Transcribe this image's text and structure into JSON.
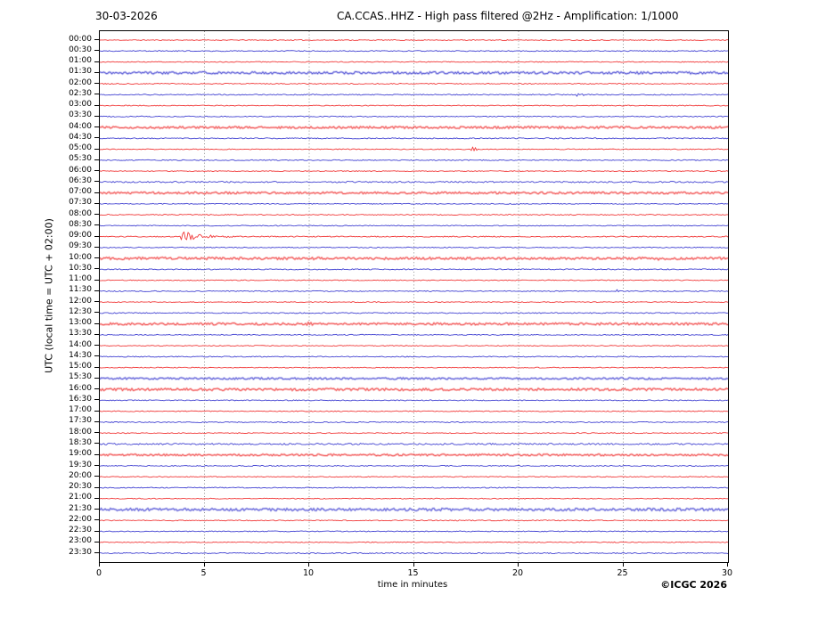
{
  "header": {
    "date": "30-03-2026",
    "title": "CA.CCAS..HHZ - High pass filtered @2Hz - Amplification: 1/1000"
  },
  "axes": {
    "y_label": "UTC (local time = UTC + 02:00)",
    "x_label": "time in minutes",
    "x_ticks": [
      0,
      5,
      10,
      15,
      20,
      25,
      30
    ],
    "x_range": [
      0,
      30
    ]
  },
  "footer": {
    "copyright": "©ICGC 2026"
  },
  "colors": {
    "trace_red": "#f03030",
    "trace_blue": "#3a3ad0",
    "grid": "#777777",
    "axis": "#000000"
  },
  "chart_data": {
    "type": "line",
    "subtype": "helicorder-daily-seismogram",
    "title": "CA.CCAS..HHZ - High pass filtered @2Hz - Amplification: 1/1000",
    "date": "30-03-2026",
    "xlabel": "time in minutes",
    "ylabel": "UTC (local time = UTC + 02:00)",
    "x_range_minutes": [
      0,
      30
    ],
    "grid": "vertical dotted lines every 5 minutes",
    "legend": "none",
    "row_minutes": 30,
    "rows": [
      {
        "label": "00:00",
        "color": "red",
        "noise": 0.5
      },
      {
        "label": "00:30",
        "color": "blue",
        "noise": 0.55
      },
      {
        "label": "01:00",
        "color": "red",
        "noise": 0.5
      },
      {
        "label": "01:30",
        "color": "blue",
        "noise": 1.3,
        "band": true
      },
      {
        "label": "02:00",
        "color": "red",
        "noise": 0.55
      },
      {
        "label": "02:30",
        "color": "blue",
        "noise": 0.6,
        "events": [
          {
            "t": 22.9,
            "amp": 2.2,
            "dur": 0.25,
            "kind": "spike"
          }
        ]
      },
      {
        "label": "03:00",
        "color": "red",
        "noise": 0.5
      },
      {
        "label": "03:30",
        "color": "blue",
        "noise": 0.55
      },
      {
        "label": "04:00",
        "color": "red",
        "noise": 1.2,
        "band": true
      },
      {
        "label": "04:30",
        "color": "blue",
        "noise": 0.6
      },
      {
        "label": "05:00",
        "color": "red",
        "noise": 0.5,
        "events": [
          {
            "t": 17.85,
            "amp": 3.5,
            "dur": 0.3,
            "kind": "spike"
          }
        ]
      },
      {
        "label": "05:30",
        "color": "blue",
        "noise": 0.55
      },
      {
        "label": "06:00",
        "color": "red",
        "noise": 0.5
      },
      {
        "label": "06:30",
        "color": "blue",
        "noise": 0.8
      },
      {
        "label": "07:00",
        "color": "red",
        "noise": 1.1,
        "band": true
      },
      {
        "label": "07:30",
        "color": "blue",
        "noise": 0.5
      },
      {
        "label": "08:00",
        "color": "red",
        "noise": 0.55
      },
      {
        "label": "08:30",
        "color": "blue",
        "noise": 0.5
      },
      {
        "label": "09:00",
        "color": "red",
        "noise": 0.6,
        "events": [
          {
            "t": 3.95,
            "amp": 6.5,
            "dur": 2.6,
            "kind": "burst"
          }
        ]
      },
      {
        "label": "09:30",
        "color": "blue",
        "noise": 0.55
      },
      {
        "label": "10:00",
        "color": "red",
        "noise": 1.3,
        "band": true,
        "events": [
          {
            "t": 26.7,
            "amp": 1.6,
            "dur": 0.4,
            "kind": "spike"
          }
        ]
      },
      {
        "label": "10:30",
        "color": "blue",
        "noise": 0.6
      },
      {
        "label": "11:00",
        "color": "red",
        "noise": 0.5
      },
      {
        "label": "11:30",
        "color": "blue",
        "noise": 0.55,
        "events": [
          {
            "t": 24.7,
            "amp": 1.4,
            "dur": 0.2,
            "kind": "spike"
          }
        ]
      },
      {
        "label": "12:00",
        "color": "red",
        "noise": 0.5
      },
      {
        "label": "12:30",
        "color": "blue",
        "noise": 0.6
      },
      {
        "label": "13:00",
        "color": "red",
        "noise": 1.2,
        "band": true,
        "events": [
          {
            "t": 10.0,
            "amp": 1.3,
            "dur": 0.25,
            "kind": "spike"
          }
        ]
      },
      {
        "label": "13:30",
        "color": "blue",
        "noise": 0.55
      },
      {
        "label": "14:00",
        "color": "red",
        "noise": 0.5
      },
      {
        "label": "14:30",
        "color": "blue",
        "noise": 0.55
      },
      {
        "label": "15:00",
        "color": "red",
        "noise": 0.5
      },
      {
        "label": "15:30",
        "color": "blue",
        "noise": 1.0,
        "band": true
      },
      {
        "label": "16:00",
        "color": "red",
        "noise": 1.3,
        "band": true
      },
      {
        "label": "16:30",
        "color": "blue",
        "noise": 0.55
      },
      {
        "label": "17:00",
        "color": "red",
        "noise": 0.5
      },
      {
        "label": "17:30",
        "color": "blue",
        "noise": 0.55
      },
      {
        "label": "18:00",
        "color": "red",
        "noise": 0.5
      },
      {
        "label": "18:30",
        "color": "blue",
        "noise": 0.9
      },
      {
        "label": "19:00",
        "color": "red",
        "noise": 1.0,
        "band": true
      },
      {
        "label": "19:30",
        "color": "blue",
        "noise": 0.55
      },
      {
        "label": "20:00",
        "color": "red",
        "noise": 0.5
      },
      {
        "label": "20:30",
        "color": "blue",
        "noise": 0.55
      },
      {
        "label": "21:00",
        "color": "red",
        "noise": 0.5
      },
      {
        "label": "21:30",
        "color": "blue",
        "noise": 1.4,
        "band": true
      },
      {
        "label": "22:00",
        "color": "red",
        "noise": 0.55
      },
      {
        "label": "22:30",
        "color": "blue",
        "noise": 0.5
      },
      {
        "label": "23:00",
        "color": "red",
        "noise": 0.5
      },
      {
        "label": "23:30",
        "color": "blue",
        "noise": 0.6
      }
    ]
  }
}
